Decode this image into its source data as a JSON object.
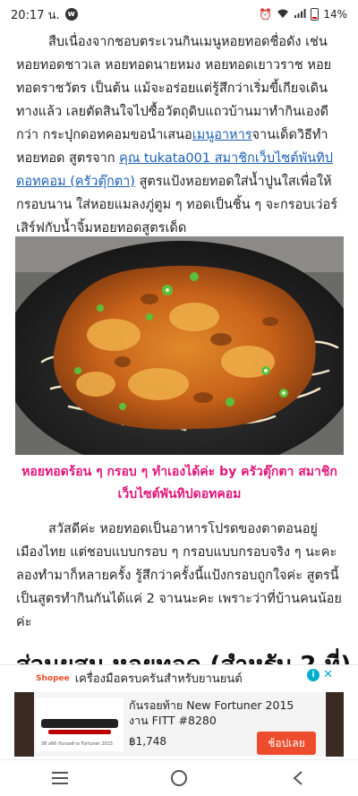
{
  "status": {
    "time": "20:17 น.",
    "battery": "14%"
  },
  "article": {
    "intro_parts": [
      "สืบเนื่องจากชอบตระเวนกินเมนูหอยทอดชื่อดัง เช่น หอยทอดชาวเล หอยทอดนายหมง หอยทอดเยาวราช หอยทอดราชวัตร เป็นต้น แม้จะอร่อยแต่รู้สึกว่าเริ่มขี้เกียจเดินทางแล้ว เลยตัดสินใจไปซื้อวัตถุดิบแถวบ้านมาทำกินเองดีกว่า กระปุกดอทคอมขอนำเสนอ",
      "เมนูอาหาร",
      "จานเด็ดวิธีทำหอยทอด สูตรจาก ",
      "คุณ tukata001 สมาชิกเว็บไซต์พันทิปดอทคอม (ครัวตุ๊กตา)",
      " สูตรแป้งหอยทอดใส่น้ำปูนใสเพื่อให้กรอบนาน ใส่หอยแมลงภู่ตูม ๆ ทอดเป็นชิ้น ๆ จะกรอบเว่อร์ เสิร์ฟกับน้ำจิ้มหอยทอดสูตรเด็ด"
    ],
    "caption": "หอยทอดร้อน ๆ กรอบ ๆ ทำเองได้ค่ะ by ครัวตุ๊กตา สมาชิกเว็บไซต์พันทิปดอทคอม",
    "paragraph2": "สวัสดีค่ะ หอยทอดเป็นอาหารโปรดของตาตอนอยู่เมืองไทย แต่ชอบแบบกรอบ ๆ กรอบแบบกรอบจริง ๆ นะคะ ลองทำมาก็หลายครั้ง รู้สึกว่าครั้งนี้แป้งกรอบถูกใจค่ะ สูตรนี้เป็นสูตรทำกินกันได้แค่ 2 จานนะคะ เพราะว่าที่บ้านคนน้อยค่ะ",
    "heading": "ส่วนผสม หอยทอด (สำหรับ 2 ที่)"
  },
  "ad": {
    "brand": "Shopee",
    "headline": "เครื่องมือครบครันสำหรับยานยนต์",
    "product_title": "กันรอยท้าย New Fortuner 2015 งาน FITT #8280",
    "price": "฿1,748",
    "cta": "ช้อปเลย",
    "thumb_text": "38 x66 กันรอยท้าย Fortuner 2015"
  },
  "colors": {
    "link": "#1a5fb4",
    "caption": "#e0157a",
    "shopee": "#ee4d2d",
    "ad_choice": "#00aecd"
  },
  "nav": [
    "recent-apps-icon",
    "home-icon",
    "back-icon"
  ]
}
